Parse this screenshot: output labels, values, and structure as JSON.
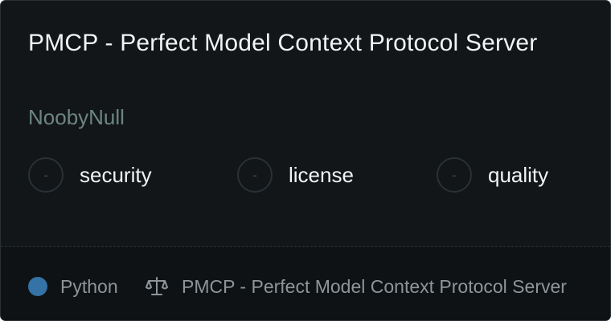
{
  "card": {
    "title": "PMCP - Perfect Model Context Protocol Server",
    "author": "NoobyNull",
    "badges": [
      {
        "symbol": "-",
        "label": "security"
      },
      {
        "symbol": "-",
        "label": "license"
      },
      {
        "symbol": "-",
        "label": "quality"
      }
    ],
    "footer": {
      "language": "Python",
      "language_color": "#3572a5",
      "license_icon": "scale-icon",
      "license_text": "PMCP - Perfect Model Context Protocol Server"
    }
  }
}
